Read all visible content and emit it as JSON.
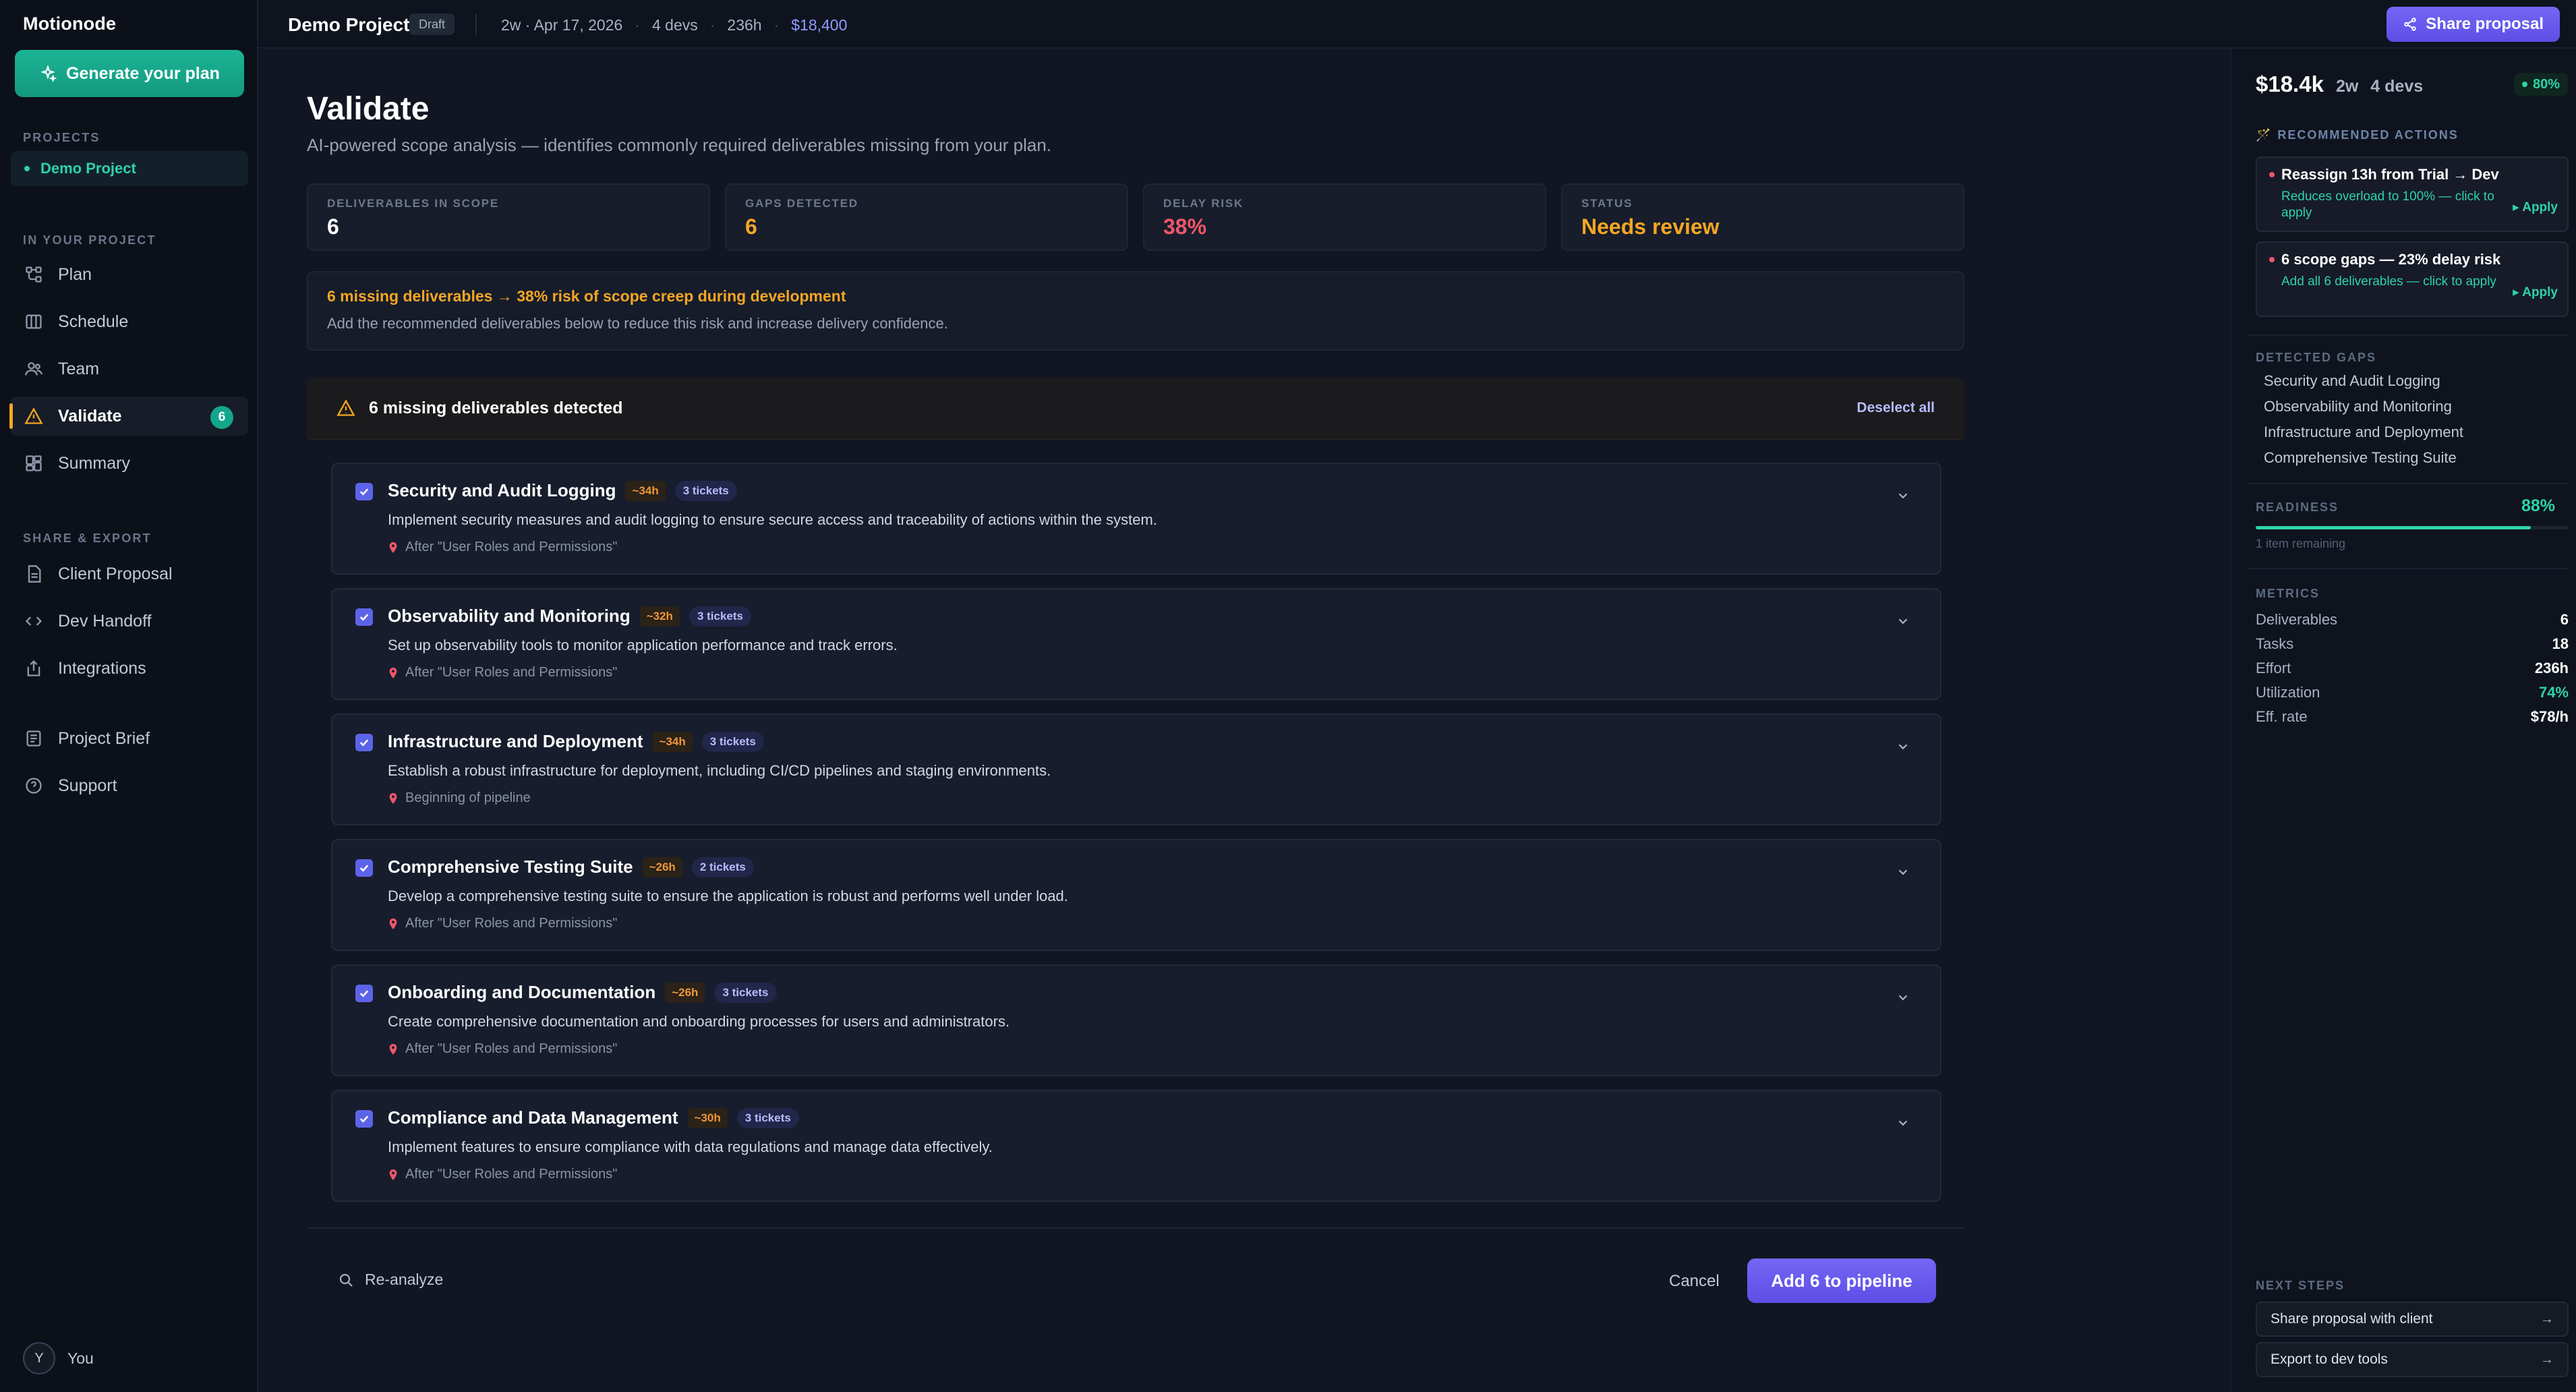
{
  "brand": "Motionode",
  "sidebar": {
    "generate_label": "Generate your plan",
    "projects_label": "PROJECTS",
    "project_item": "Demo Project",
    "in_project_label": "IN YOUR PROJECT",
    "nav": [
      {
        "label": "Plan",
        "icon": "plan-icon"
      },
      {
        "label": "Schedule",
        "icon": "schedule-icon"
      },
      {
        "label": "Team",
        "icon": "team-icon"
      },
      {
        "label": "Validate",
        "icon": "warning-icon",
        "badge": "6"
      },
      {
        "label": "Summary",
        "icon": "summary-icon"
      }
    ],
    "share_label": "SHARE & EXPORT",
    "share_nav": [
      {
        "label": "Client Proposal",
        "icon": "document-icon"
      },
      {
        "label": "Dev Handoff",
        "icon": "code-icon"
      },
      {
        "label": "Integrations",
        "icon": "integrations-icon"
      }
    ],
    "extra_nav": [
      {
        "label": "Project Brief",
        "icon": "brief-icon"
      },
      {
        "label": "Support",
        "icon": "help-icon"
      }
    ],
    "user": {
      "initial": "Y",
      "name": "You"
    }
  },
  "topbar": {
    "project_title": "Demo Project",
    "status": "Draft",
    "duration": "2w · Apr 17, 2026",
    "devs": "4 devs",
    "hours": "236h",
    "cost": "$18,400",
    "share_label": "Share proposal"
  },
  "main": {
    "title": "Validate",
    "subtitle": "AI-powered scope analysis — identifies commonly required deliverables missing from your plan.",
    "stats": [
      {
        "label": "DELIVERABLES IN SCOPE",
        "value": "6",
        "color": "#ffffff"
      },
      {
        "label": "GAPS DETECTED",
        "value": "6",
        "color": "#f5a623"
      },
      {
        "label": "DELAY RISK",
        "value": "38%",
        "color": "#f0566a"
      },
      {
        "label": "STATUS",
        "value": "Needs review",
        "color": "#f5a623"
      }
    ],
    "alert": {
      "headline": "6 missing deliverables → 38% risk of scope creep during development",
      "detail": "Add the recommended deliverables below to reduce this risk and increase delivery confidence."
    },
    "missing": {
      "text": "6 missing deliverables detected",
      "deselect": "Deselect all"
    },
    "deliverables": [
      {
        "title": "Security and Audit Logging",
        "hours": "~34h",
        "tickets": "3 tickets",
        "desc": "Implement security measures and audit logging to ensure secure access and traceability of actions within the system.",
        "after": "After \"User Roles and Permissions\""
      },
      {
        "title": "Observability and Monitoring",
        "hours": "~32h",
        "tickets": "3 tickets",
        "desc": "Set up observability tools to monitor application performance and track errors.",
        "after": "After \"User Roles and Permissions\""
      },
      {
        "title": "Infrastructure and Deployment",
        "hours": "~34h",
        "tickets": "3 tickets",
        "desc": "Establish a robust infrastructure for deployment, including CI/CD pipelines and staging environments.",
        "after": "Beginning of pipeline"
      },
      {
        "title": "Comprehensive Testing Suite",
        "hours": "~26h",
        "tickets": "2 tickets",
        "desc": "Develop a comprehensive testing suite to ensure the application is robust and performs well under load.",
        "after": "After \"User Roles and Permissions\""
      },
      {
        "title": "Onboarding and Documentation",
        "hours": "~26h",
        "tickets": "3 tickets",
        "desc": "Create comprehensive documentation and onboarding processes for users and administrators.",
        "after": "After \"User Roles and Permissions\""
      },
      {
        "title": "Compliance and Data Management",
        "hours": "~30h",
        "tickets": "3 tickets",
        "desc": "Implement features to ensure compliance with data regulations and manage data effectively.",
        "after": "After \"User Roles and Permissions\""
      }
    ],
    "reanalyze": "Re-analyze",
    "cancel": "Cancel",
    "add": "Add 6 to pipeline"
  },
  "rpanel": {
    "amount": "$18.4k",
    "duration": "2w",
    "devs": "4 devs",
    "confidence": "80%",
    "rec_label": "RECOMMENDED ACTIONS",
    "recs": [
      {
        "title": "Reassign 13h from Trial → Dev",
        "sub": "Reduces overload to 100% — click to apply",
        "apply": "▸ Apply"
      },
      {
        "title": "6 scope gaps — 23% delay risk",
        "sub": "Add all 6 deliverables — click to apply",
        "apply": "▸ Apply"
      }
    ],
    "gaps_label": "DETECTED GAPS",
    "gaps": [
      "Security and Audit Logging",
      "Observability and Monitoring",
      "Infrastructure and Deployment",
      "Comprehensive Testing Suite"
    ],
    "readiness_label": "READINESS",
    "readiness": "88%",
    "readiness_fraction": 0.88,
    "remaining": "1 item remaining",
    "metrics_label": "METRICS",
    "metrics": [
      {
        "k": "Deliverables",
        "v": "6"
      },
      {
        "k": "Tasks",
        "v": "18"
      },
      {
        "k": "Effort",
        "v": "236h"
      },
      {
        "k": "Utilization",
        "v": "74%"
      },
      {
        "k": "Eff. rate",
        "v": "$78/h"
      }
    ],
    "next_label": "NEXT STEPS",
    "next": [
      "Share proposal with client",
      "Export to dev tools"
    ]
  }
}
